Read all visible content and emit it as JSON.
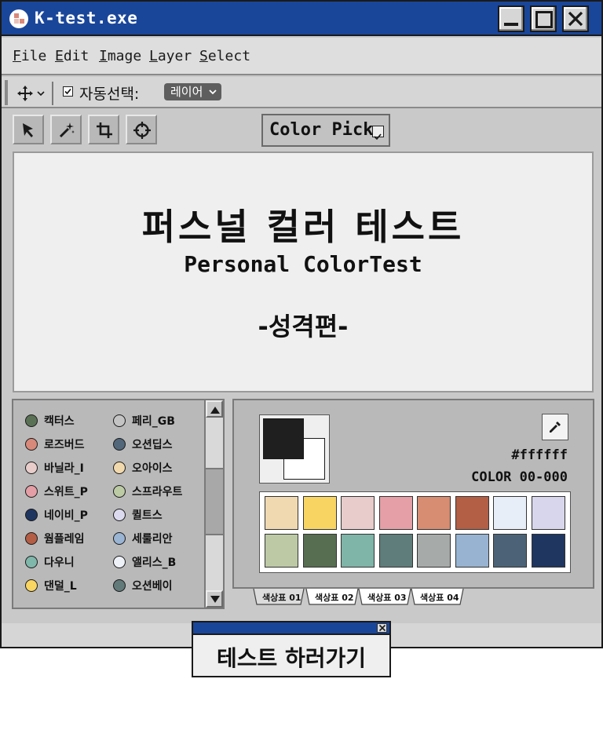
{
  "window": {
    "title": "K-test.exe"
  },
  "menu": {
    "items": [
      {
        "label": "File",
        "mnemonic": "F",
        "rest": "ile"
      },
      {
        "label": "Edit",
        "mnemonic": "E",
        "rest": "dit"
      },
      {
        "label": "Image",
        "mnemonic": "I",
        "rest": "mage"
      },
      {
        "label": "Layer",
        "mnemonic": "L",
        "rest": "ayer"
      },
      {
        "label": "Select",
        "mnemonic": "S",
        "rest": "elect"
      }
    ]
  },
  "options": {
    "autoselect_label": "자동선택:",
    "autoselect_checked": true,
    "layer_value": "레이어"
  },
  "toolbar": {
    "colorpick_label": "Color Pick",
    "tools": [
      "arrow-icon",
      "magic-wand-icon",
      "crop-icon",
      "target-icon"
    ]
  },
  "canvas": {
    "title": "퍼스널 컬러 테스트",
    "subtitle": "Personal ColorTest",
    "tag": "-성격편-"
  },
  "types": {
    "col1": [
      {
        "label": "캑터스",
        "color": "#5a7155"
      },
      {
        "label": "로즈버드",
        "color": "#d8897a"
      },
      {
        "label": "바닐라_I",
        "color": "#e8cdca"
      },
      {
        "label": "스위트_P",
        "color": "#e49ea5"
      },
      {
        "label": "네이비_P",
        "color": "#1e3560"
      },
      {
        "label": "웜플레임",
        "color": "#b35e45"
      },
      {
        "label": "다우니",
        "color": "#7fb7aa"
      },
      {
        "label": "댄덜_L",
        "color": "#f9d562"
      }
    ],
    "col2": [
      {
        "label": "페리_GB",
        "color": "#c4c4c4"
      },
      {
        "label": "오션딥스",
        "color": "#52677a"
      },
      {
        "label": "오아이스",
        "color": "#f2d9ad"
      },
      {
        "label": "스프라우트",
        "color": "#bccba4"
      },
      {
        "label": "퀼트스",
        "color": "#dcdaee"
      },
      {
        "label": "세룰리안",
        "color": "#9ab4d4"
      },
      {
        "label": "앨리스_B",
        "color": "#eef1f8"
      },
      {
        "label": "오션베이",
        "color": "#627a79"
      }
    ]
  },
  "swatches": {
    "hex": "#ffffff",
    "code": "COLOR 00-000",
    "foreground": "#1f1f1f",
    "background": "#ffffff",
    "row1": [
      "#f0d9b1",
      "#f8d563",
      "#e7cccb",
      "#e59fa6",
      "#d68d72",
      "#b25f46",
      "#e8eef8",
      "#d8d6ec"
    ],
    "row2": [
      "#bcc9a4",
      "#576e51",
      "#7fb4a8",
      "#5e7d7b",
      "#a6aaa9",
      "#97b3d1",
      "#4c6377",
      "#1f3660"
    ]
  },
  "tabs": [
    "색상표 01",
    "색상표 02",
    "색상표 03",
    "색상표 04"
  ],
  "popup": {
    "label": "테스트 하러가기"
  }
}
